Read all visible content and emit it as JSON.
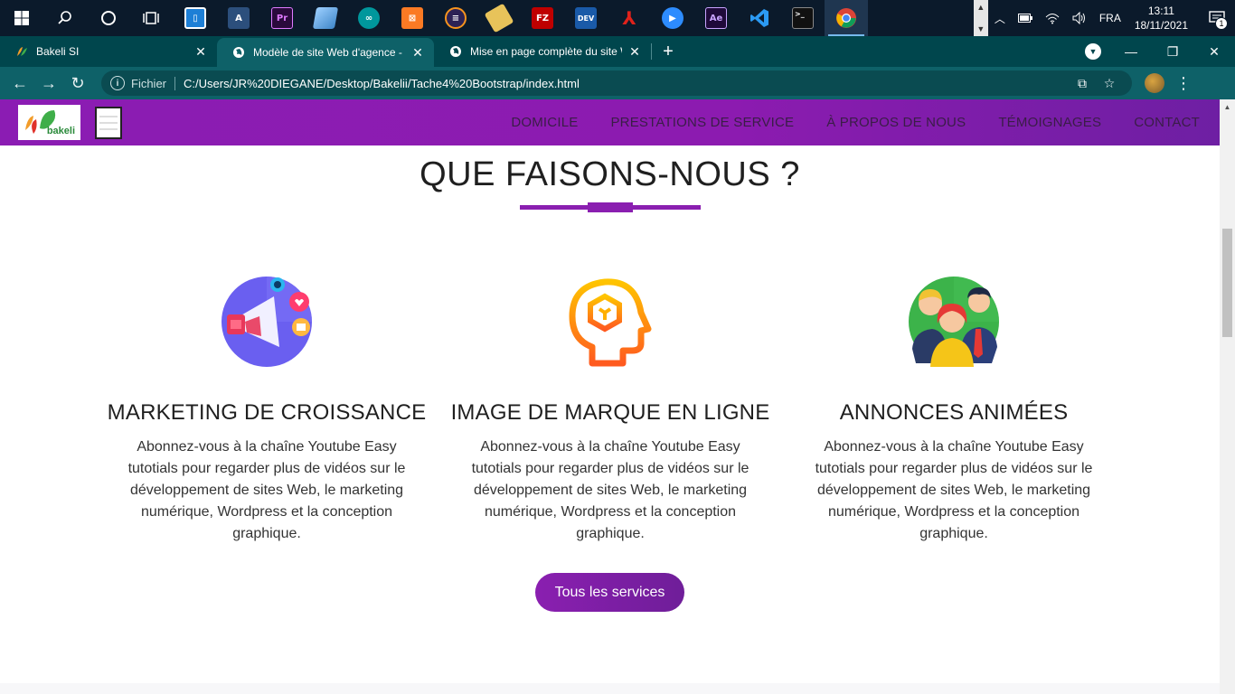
{
  "taskbar": {
    "apps": [
      {
        "icon": "search-icon"
      },
      {
        "icon": "cortana-icon"
      },
      {
        "icon": "task-view-icon"
      },
      {
        "icon": "app-icon-blue",
        "label": ""
      },
      {
        "icon": "app-icon-ao",
        "label": "A"
      },
      {
        "icon": "premiere-icon",
        "label": "Pr"
      },
      {
        "icon": "app-icon-bluebook",
        "label": ""
      },
      {
        "icon": "arduino-icon",
        "label": ""
      },
      {
        "icon": "xampp-icon",
        "label": ""
      },
      {
        "icon": "eclipse-icon",
        "label": ""
      },
      {
        "icon": "app-icon-yellow",
        "label": ""
      },
      {
        "icon": "filezilla-icon",
        "label": "FZ"
      },
      {
        "icon": "devcpp-icon",
        "label": "DEV"
      },
      {
        "icon": "acrobat-icon",
        "label": ""
      },
      {
        "icon": "zoom-icon",
        "label": ""
      },
      {
        "icon": "after-effects-icon",
        "label": "Ae"
      },
      {
        "icon": "vscode-icon",
        "label": ""
      },
      {
        "icon": "terminal-icon",
        "label": ""
      },
      {
        "icon": "chrome-icon",
        "label": ""
      }
    ],
    "language": "FRA",
    "time": "13:11",
    "date": "18/11/2021",
    "notification_count": "1"
  },
  "browser": {
    "tabs": [
      {
        "title": "Bakeli SI",
        "active": false
      },
      {
        "title": "Modèle de site Web d'agence - T",
        "active": true
      },
      {
        "title": "Mise en page complète du site W",
        "active": false
      }
    ],
    "address": {
      "scheme_label": "Fichier",
      "url": "C:/Users/JR%20DIEGANE/Desktop/Bakelii/Tache4%20Bootstrap/index.html"
    }
  },
  "site": {
    "logo_text": "bakeli",
    "nav": [
      "DOMICILE",
      "PRESTATIONS DE SERVICE",
      "À PROPOS DE NOUS",
      "TÉMOIGNAGES",
      "CONTACT"
    ],
    "section_title": "QUE FAISONS-NOUS ?",
    "services": [
      {
        "icon": "megaphone-icon",
        "title": "MARKETING DE CROISSANCE",
        "text": "Abonnez-vous à la chaîne Youtube Easy tutotials pour regarder plus de vidéos sur le développement de sites Web, le marketing numérique, Wordpress et la conception graphique."
      },
      {
        "icon": "brain-head-icon",
        "title": "IMAGE DE MARQUE EN LIGNE",
        "text": "Abonnez-vous à la chaîne Youtube Easy tutotials pour regarder plus de vidéos sur le développement de sites Web, le marketing numérique, Wordpress et la conception graphique."
      },
      {
        "icon": "people-group-icon",
        "title": "ANNONCES ANIMÉES",
        "text": "Abonnez-vous à la chaîne Youtube Easy tutotials pour regarder plus de vidéos sur le développement de sites Web, le marketing numérique, Wordpress et la conception graphique."
      }
    ],
    "cta_label": "Tous les services"
  },
  "colors": {
    "brand_purple": "#8a1fb0",
    "taskbar": "#0b1a2b",
    "tab_strip": "#00464d",
    "toolbar": "#0e6168"
  }
}
